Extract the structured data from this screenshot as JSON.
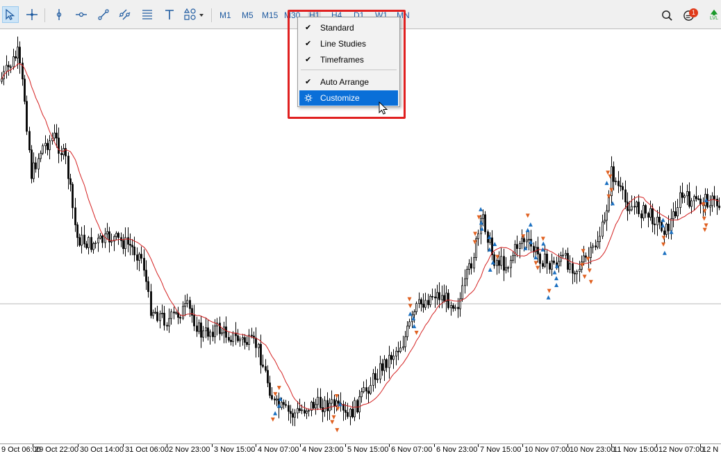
{
  "toolbar": {
    "tools": [
      {
        "name": "select-cursor-button",
        "icon": "cursor-arrow-icon",
        "active": true
      },
      {
        "name": "crosshair-button",
        "icon": "crosshair-icon",
        "active": false
      },
      {
        "name": "vertical-line-button",
        "icon": "vertical-line-icon",
        "active": false
      },
      {
        "name": "horizontal-line-button",
        "icon": "horizontal-line-icon",
        "active": false
      },
      {
        "name": "trendline-button",
        "icon": "trendline-icon",
        "active": false
      },
      {
        "name": "equidistant-channel-button",
        "icon": "channel-icon",
        "active": false
      },
      {
        "name": "fibonacci-button",
        "icon": "fibonacci-icon",
        "active": false
      },
      {
        "name": "text-button",
        "icon": "text-icon",
        "active": false
      },
      {
        "name": "shapes-button",
        "icon": "shapes-icon",
        "active": false
      }
    ],
    "timeframes": [
      "M1",
      "M5",
      "M15",
      "M30",
      "H1",
      "H4",
      "D1",
      "W1",
      "MN"
    ],
    "selected_timeframe": "H1",
    "notifications_count": "1",
    "right_icons": [
      "search-icon",
      "chat-icon",
      "signal-level-icon"
    ],
    "signal_label": "LVL"
  },
  "context_menu": {
    "items": [
      {
        "label": "Standard",
        "checked": true
      },
      {
        "label": "Line Studies",
        "checked": true
      },
      {
        "label": "Timeframes",
        "checked": true
      },
      {
        "label": "Auto Arrange",
        "checked": true
      },
      {
        "label": "Customize",
        "checked": false,
        "highlighted": true,
        "icon": "gear-icon"
      }
    ]
  },
  "x_axis_labels": [
    "9 Oct 06:00",
    "29 Oct 22:00",
    "30 Oct 14:00",
    "31 Oct 06:00",
    "2 Nov 23:00",
    "3 Nov 15:00",
    "4 Nov 07:00",
    "4 Nov 23:00",
    "5 Nov 15:00",
    "6 Nov 07:00",
    "6 Nov 23:00",
    "7 Nov 15:00",
    "10 Nov 07:00",
    "10 Nov 23:00",
    "11 Nov 15:00",
    "12 Nov 07:00",
    "12 N"
  ],
  "colors": {
    "moving_average": "#d42020",
    "candles": "#000000",
    "up_arrow": "#1a6fc0",
    "down_arrow": "#e06020",
    "accent": "#0a6fd8",
    "highlight_box": "#e02020"
  }
}
